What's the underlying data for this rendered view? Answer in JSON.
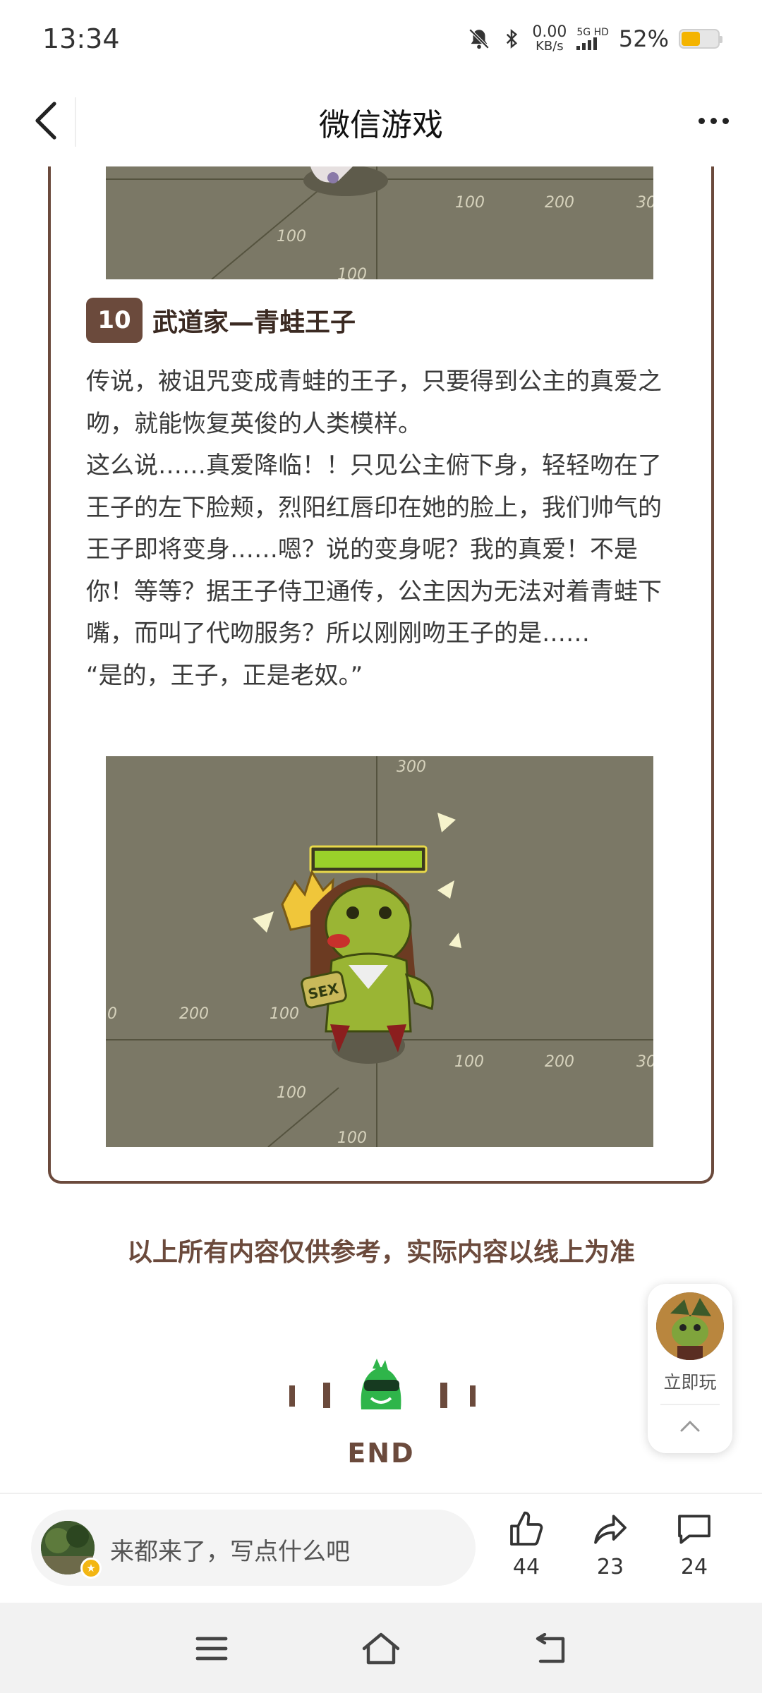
{
  "status_bar": {
    "time": "13:34",
    "net_speed_value": "0.00",
    "net_speed_unit": "KB/s",
    "network_type": "5G HD",
    "battery_pct": "52%",
    "battery_level": 0.52
  },
  "nav": {
    "title": "微信游戏"
  },
  "top_image": {
    "tick_labels": [
      "100",
      "200",
      "30",
      "100",
      "100"
    ]
  },
  "section": {
    "number": "10",
    "title": "武道家—青蛙王子",
    "paragraphs": [
      "传说，被诅咒变成青蛙的王子，只要得到公主的真爱之吻，就能恢复英俊的人类模样。",
      "这么说……真爱降临！！只见公主俯下身，轻轻吻在了王子的左下脸颊，烈阳红唇印在她的脸上，我们帅气的王子即将变身……嗯？说的变身呢？我的真爱！不是你！等等？据王子侍卫通传，公主因为无法对着青蛙下嘴，而叫了代吻服务？所以刚刚吻王子的是……",
      "“是的，王子，正是老奴。”"
    ]
  },
  "frog_image": {
    "tick_labels": [
      "300",
      "0",
      "200",
      "100",
      "100",
      "200",
      "30",
      "100",
      "100"
    ],
    "shirt_text": "SEX"
  },
  "disclaimer": "以上所有内容仅供参考，实际内容以线上为准",
  "end_label": "END",
  "play_widget": {
    "label": "立即玩"
  },
  "action_bar": {
    "comment_placeholder": "来都来了，写点什么吧",
    "likes": "44",
    "shares": "23",
    "comments": "24"
  },
  "colors": {
    "accent_brown": "#6b4a3c",
    "map_bg": "#7b7866",
    "battery": "#f4b400"
  },
  "icons": [
    "back-arrow-icon",
    "more-icon",
    "thumbs-up-icon",
    "share-icon",
    "comment-icon",
    "chevron-up-icon",
    "menu-icon",
    "home-icon",
    "back-icon"
  ]
}
